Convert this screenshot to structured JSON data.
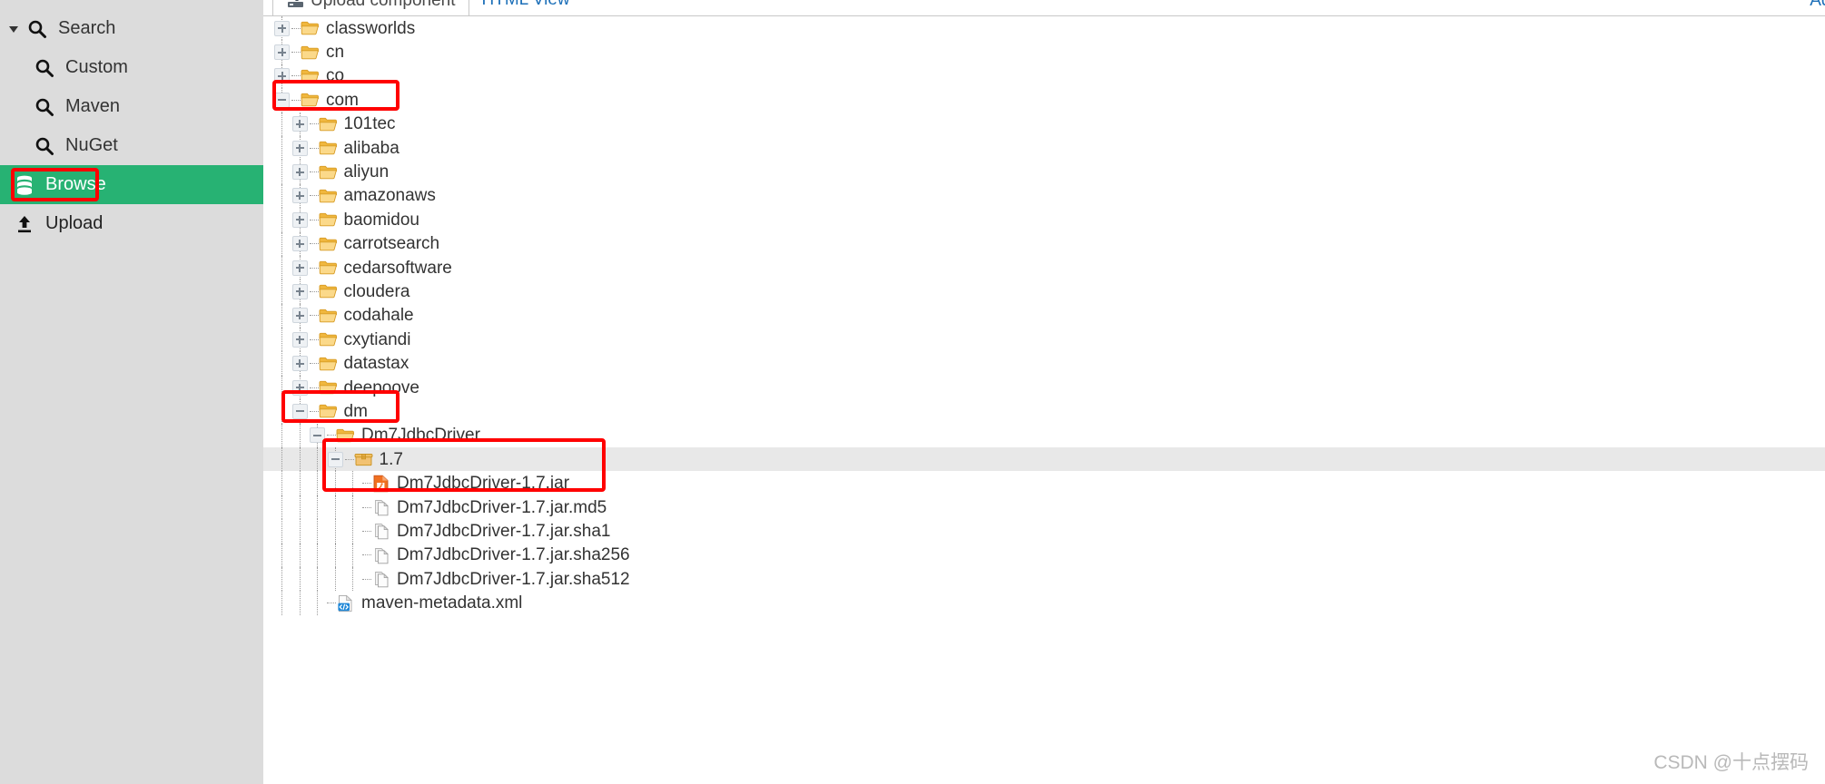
{
  "colors": {
    "sidebar_bg": "#dcdcdc",
    "browse_active_bg": "#27b273",
    "annotation_red": "#ff0000",
    "link_blue": "#1c6fb8",
    "selected_row_bg": "#e8e8e8",
    "folder_yellow": "#f5c76a",
    "jar_orange": "#f07020"
  },
  "sidebar": {
    "search_group": {
      "label": "Search",
      "icon": "search-icon",
      "caret": "caret-down-icon",
      "expanded": true,
      "items": [
        {
          "label": "Custom",
          "icon": "search-icon"
        },
        {
          "label": "Maven",
          "icon": "search-icon"
        },
        {
          "label": "NuGet",
          "icon": "search-icon"
        }
      ]
    },
    "browse": {
      "label": "Browse",
      "icon": "database-icon",
      "active": true,
      "annotated": true
    },
    "upload": {
      "label": "Upload",
      "icon": "upload-icon",
      "active": false
    }
  },
  "main": {
    "tabs": [
      {
        "label": "Upload component",
        "icon": "upload-component-icon",
        "active": true
      },
      {
        "label": "HTML View",
        "icon": null,
        "active": false
      }
    ],
    "right_link": "Adv"
  },
  "tree": {
    "rows": [
      {
        "label": "classworlds",
        "depth": 1,
        "icon": "folder-icon",
        "state": "plus",
        "selected": false
      },
      {
        "label": "cn",
        "depth": 1,
        "icon": "folder-icon",
        "state": "plus",
        "selected": false
      },
      {
        "label": "co",
        "depth": 1,
        "icon": "folder-icon",
        "state": "plus",
        "selected": false
      },
      {
        "label": "com",
        "depth": 1,
        "icon": "folder-icon",
        "state": "minus",
        "selected": false
      },
      {
        "label": "101tec",
        "depth": 2,
        "icon": "folder-icon",
        "state": "plus",
        "selected": false
      },
      {
        "label": "alibaba",
        "depth": 2,
        "icon": "folder-icon",
        "state": "plus",
        "selected": false
      },
      {
        "label": "aliyun",
        "depth": 2,
        "icon": "folder-icon",
        "state": "plus",
        "selected": false
      },
      {
        "label": "amazonaws",
        "depth": 2,
        "icon": "folder-icon",
        "state": "plus",
        "selected": false
      },
      {
        "label": "baomidou",
        "depth": 2,
        "icon": "folder-icon",
        "state": "plus",
        "selected": false
      },
      {
        "label": "carrotsearch",
        "depth": 2,
        "icon": "folder-icon",
        "state": "plus",
        "selected": false
      },
      {
        "label": "cedarsoftware",
        "depth": 2,
        "icon": "folder-icon",
        "state": "plus",
        "selected": false
      },
      {
        "label": "cloudera",
        "depth": 2,
        "icon": "folder-icon",
        "state": "plus",
        "selected": false
      },
      {
        "label": "codahale",
        "depth": 2,
        "icon": "folder-icon",
        "state": "plus",
        "selected": false
      },
      {
        "label": "cxytiandi",
        "depth": 2,
        "icon": "folder-icon",
        "state": "plus",
        "selected": false
      },
      {
        "label": "datastax",
        "depth": 2,
        "icon": "folder-icon",
        "state": "plus",
        "selected": false
      },
      {
        "label": "deepoove",
        "depth": 2,
        "icon": "folder-icon",
        "state": "plus",
        "selected": false
      },
      {
        "label": "dm",
        "depth": 2,
        "icon": "folder-icon",
        "state": "minus",
        "selected": false
      },
      {
        "label": "Dm7JdbcDriver",
        "depth": 3,
        "icon": "folder-icon",
        "state": "minus",
        "selected": false
      },
      {
        "label": "1.7",
        "depth": 4,
        "icon": "package-icon",
        "state": "minus",
        "selected": true
      },
      {
        "label": "Dm7JdbcDriver-1.7.jar",
        "depth": 5,
        "icon": "jar-icon",
        "state": "leaf",
        "selected": false
      },
      {
        "label": "Dm7JdbcDriver-1.7.jar.md5",
        "depth": 5,
        "icon": "checksum-icon",
        "state": "leaf",
        "selected": false
      },
      {
        "label": "Dm7JdbcDriver-1.7.jar.sha1",
        "depth": 5,
        "icon": "checksum-icon",
        "state": "leaf",
        "selected": false
      },
      {
        "label": "Dm7JdbcDriver-1.7.jar.sha256",
        "depth": 5,
        "icon": "checksum-icon",
        "state": "leaf",
        "selected": false
      },
      {
        "label": "Dm7JdbcDriver-1.7.jar.sha512",
        "depth": 5,
        "icon": "checksum-icon",
        "state": "leaf",
        "selected": false
      },
      {
        "label": "maven-metadata.xml",
        "depth": 3,
        "icon": "xml-icon",
        "state": "leaf",
        "selected": false
      }
    ]
  },
  "watermark": "CSDN @十点摆码"
}
